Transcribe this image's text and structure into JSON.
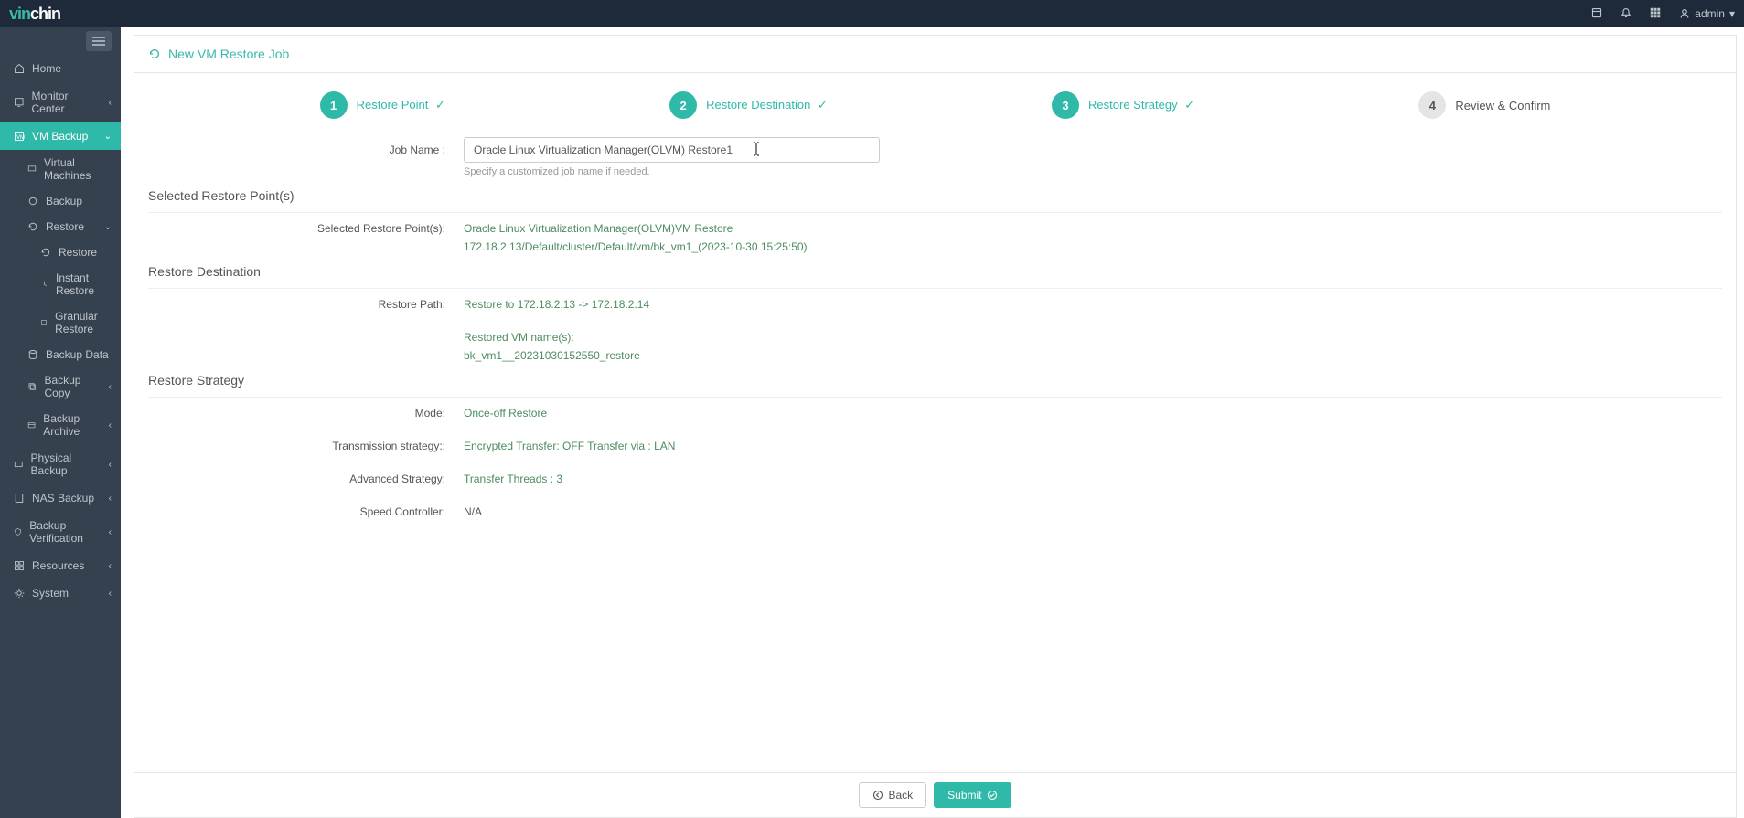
{
  "header": {
    "logo_part1": "vin",
    "logo_part2": "chin",
    "user": "admin"
  },
  "sidebar": {
    "home": "Home",
    "monitor_center": "Monitor Center",
    "vm_backup": "VM Backup",
    "virtual_machines": "Virtual Machines",
    "backup": "Backup",
    "restore": "Restore",
    "restore_sub": "Restore",
    "instant_restore": "Instant Restore",
    "granular_restore": "Granular Restore",
    "backup_data": "Backup Data",
    "backup_copy": "Backup Copy",
    "backup_archive": "Backup Archive",
    "physical_backup": "Physical Backup",
    "nas_backup": "NAS Backup",
    "backup_verification": "Backup Verification",
    "resources": "Resources",
    "system": "System"
  },
  "page": {
    "title": "New VM Restore Job",
    "steps": {
      "s1_num": "1",
      "s1_label": "Restore Point",
      "s2_num": "2",
      "s2_label": "Restore Destination",
      "s3_num": "3",
      "s3_label": "Restore Strategy",
      "s4_num": "4",
      "s4_label": "Review & Confirm"
    },
    "job_name_label": "Job Name :",
    "job_name_value": "Oracle Linux Virtualization Manager(OLVM) Restore1",
    "job_name_hint": "Specify a customized job name if needed.",
    "section_selected_points": "Selected Restore Point(s)",
    "selected_points_label": "Selected Restore Point(s):",
    "selected_points_line1": "Oracle Linux Virtualization Manager(OLVM)VM Restore",
    "selected_points_line2": "172.18.2.13/Default/cluster/Default/vm/bk_vm1_(2023-10-30 15:25:50)",
    "section_restore_destination": "Restore Destination",
    "restore_path_label": "Restore Path:",
    "restore_path_value": "Restore to 172.18.2.13 -> 172.18.2.14",
    "restored_vm_names_label": "Restored VM name(s):",
    "restored_vm_names_value": "bk_vm1__20231030152550_restore",
    "section_restore_strategy": "Restore Strategy",
    "mode_label": "Mode:",
    "mode_value": "Once-off Restore",
    "transmission_label": "Transmission strategy::",
    "transmission_value": "Encrypted Transfer: OFF Transfer via : LAN",
    "advanced_label": "Advanced Strategy:",
    "advanced_value": "Transfer Threads : 3",
    "speed_label": "Speed Controller:",
    "speed_value": "N/A",
    "btn_back": "Back",
    "btn_submit": "Submit"
  }
}
